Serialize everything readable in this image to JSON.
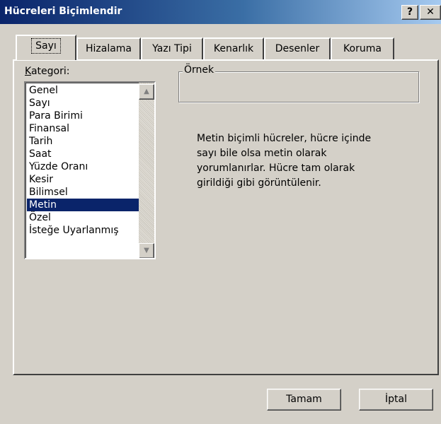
{
  "window": {
    "title": "Hücreleri Biçimlendir",
    "help_button": "?",
    "close_button": "✕"
  },
  "tabs": [
    {
      "label": "Sayı",
      "active": true
    },
    {
      "label": "Hizalama",
      "active": false
    },
    {
      "label": "Yazı Tipi",
      "active": false
    },
    {
      "label": "Kenarlık",
      "active": false
    },
    {
      "label": "Desenler",
      "active": false
    },
    {
      "label": "Koruma",
      "active": false
    }
  ],
  "category": {
    "label_accel": "K",
    "label_rest": "ategori:",
    "items": [
      "Genel",
      "Sayı",
      "Para Birimi",
      "Finansal",
      "Tarih",
      "Saat",
      "Yüzde Oranı",
      "Kesir",
      "Bilimsel",
      "Metin",
      "Özel",
      "İsteğe Uyarlanmış"
    ],
    "selected": "Metin"
  },
  "sample": {
    "label": "Örnek",
    "value": ""
  },
  "description": {
    "lines": [
      "Metin biçimli hücreler, hücre içinde",
      "sayı bile olsa metin olarak",
      "yorumlanırlar. Hücre tam olarak",
      "girildiği gibi görüntülenir."
    ]
  },
  "buttons": {
    "ok": "Tamam",
    "cancel": "İptal"
  },
  "colors": {
    "titlebar_start": "#0a246a",
    "titlebar_end": "#a6caf0",
    "face": "#d4d0c8",
    "selection": "#0a246a"
  }
}
